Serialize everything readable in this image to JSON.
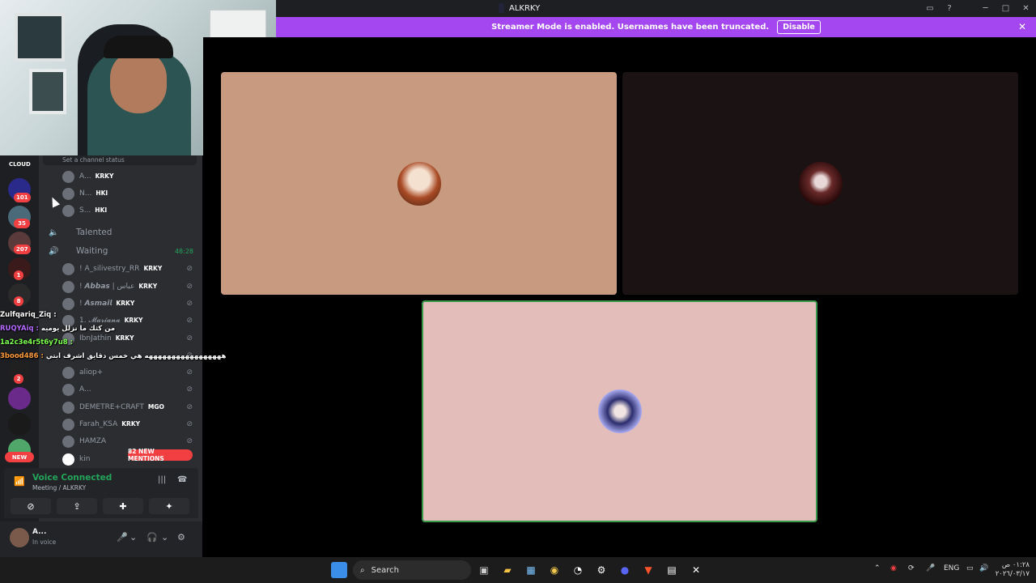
{
  "window": {
    "title": "ALKRKY",
    "icons": [
      "screen-share-icon",
      "help-icon"
    ],
    "controls": [
      "─",
      "□",
      "✕"
    ]
  },
  "banner": {
    "text": "Streamer Mode is enabled. Usernames have been truncated.",
    "button": "Disable",
    "close": "✕",
    "color": "#a447f0"
  },
  "server_rail": {
    "top_label": "CLOUD",
    "badges": [
      "101",
      "35",
      "207",
      "1",
      "8",
      "2"
    ],
    "new_badge": "NEW"
  },
  "channels": {
    "status_placeholder": "Set a channel status",
    "top_users": [
      {
        "name": "A...",
        "tag": "KRKY"
      },
      {
        "name": "N...",
        "tag": "HKI"
      },
      {
        "name": "S...",
        "tag": "HKI"
      }
    ],
    "talented": {
      "name": "Talented"
    },
    "waiting": {
      "name": "Waiting",
      "timer": "48:28"
    },
    "waiting_users": [
      {
        "name": "! A_silivestry_RR",
        "tag": "KRKY"
      },
      {
        "name": "! 𝘼𝙗𝙗𝙖𝙨 | عباس",
        "tag": "KRKY"
      },
      {
        "name": "! 𝘼𝙨𝙢𝙖𝙞𝙡",
        "tag": "KRKY"
      },
      {
        "name": "1. 𝓜𝓪𝓻𝓲𝓪𝓷𝓪",
        "tag": "KRKY"
      },
      {
        "name": "IbnJathin",
        "tag": "KRKY"
      },
      {
        "name": "",
        "tag": ""
      },
      {
        "name": "aliop+",
        "tag": ""
      },
      {
        "name": "A...",
        "tag": ""
      },
      {
        "name": "DEMETRE+CRAFT",
        "tag": "MGO"
      },
      {
        "name": "Farah_KSA",
        "tag": "KRKY"
      },
      {
        "name": "HAMZA",
        "tag": ""
      },
      {
        "name": "kin",
        "tag": ""
      }
    ],
    "mentions": "82 NEW MENTIONS"
  },
  "chat_overlay": [
    {
      "user": "Zulfqariq_Ziq :",
      "msg": "",
      "color": "#ffffff"
    },
    {
      "user": "RUQYAiq :",
      "msg": "من كثك ما نزلل يوميه",
      "color": "#b46cff"
    },
    {
      "user": "1a2c3e4r5t6y7u8 :",
      "msg": "",
      "color": "#7cff4f"
    },
    {
      "user": "3bood486 :",
      "msg": "هههههههههههههههههه هي خمس دقايق اشرف ابتي",
      "color": "#ff9a3c"
    }
  ],
  "voice_panel": {
    "title": "Voice Connected",
    "subtitle": "Meeting / ALKRKY"
  },
  "user_panel": {
    "name": "A...",
    "status": "In voice"
  },
  "taskbar": {
    "search": "Search",
    "lang": "ENG",
    "time": "٠١:٢٨ ص",
    "date": "٢٠٢٦/٠٣/١٧"
  }
}
